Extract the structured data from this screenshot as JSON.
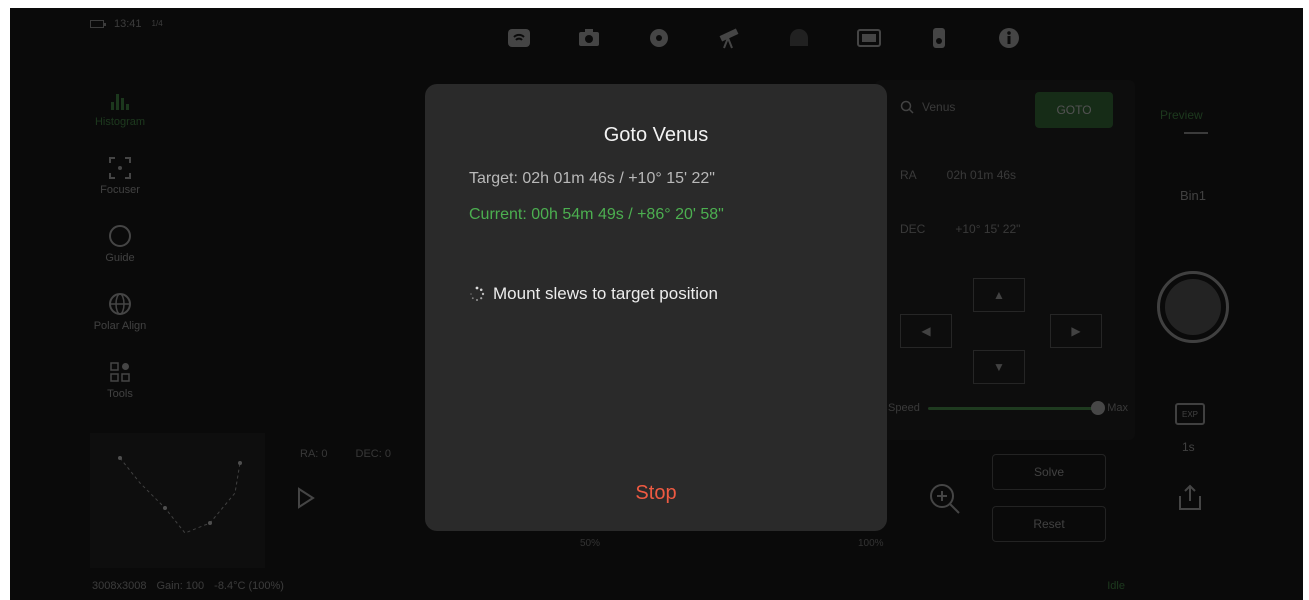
{
  "status": {
    "time": "13:41",
    "signal": "1/4"
  },
  "toolbar": {
    "icons": [
      "wifi-icon",
      "camera-icon",
      "focus-icon",
      "telescope-icon",
      "dome-icon",
      "filter-icon",
      "guide-cam-icon",
      "info-icon"
    ]
  },
  "sidebar": {
    "items": [
      {
        "label": "Histogram",
        "icon": "histogram-icon"
      },
      {
        "label": "Focuser",
        "icon": "focus-frame-icon"
      },
      {
        "label": "Guide",
        "icon": "compass-icon"
      },
      {
        "label": "Polar Align",
        "icon": "globe-icon"
      },
      {
        "label": "Tools",
        "icon": "grid-icon"
      }
    ]
  },
  "graph": {
    "label_a": "RA: 0",
    "label_b": "DEC: 0",
    "axis_left": "50%",
    "axis_right": "100%"
  },
  "bottom_status": {
    "resolution": "3008x3008",
    "gain": "Gain: 100",
    "temp": "-8.4°C (100%)",
    "state": "Idle"
  },
  "control": {
    "search_placeholder": "Venus",
    "goto_label": "GOTO",
    "ra_label": "RA",
    "ra_value": "02h 01m 46s",
    "dec_label": "DEC",
    "dec_value": "+10° 15' 22\"",
    "speed_label": "Speed",
    "speed_value": "Max",
    "speed_level": 1.0,
    "solve_label": "Solve",
    "reset_label": "Reset"
  },
  "right": {
    "preview_label": "Preview",
    "bin_label": "Bin1",
    "exposure_value": "1s",
    "exposure_icon_text": "EXP"
  },
  "modal": {
    "title": "Goto Venus",
    "target_line": "Target: 02h 01m 46s / +10° 15' 22\"",
    "current_line": "Current: 00h 54m 49s / +86° 20' 58\"",
    "status_text": "Mount slews to target position",
    "stop_label": "Stop",
    "colors": {
      "current": "#4caf50",
      "stop": "#ef5a42"
    }
  }
}
